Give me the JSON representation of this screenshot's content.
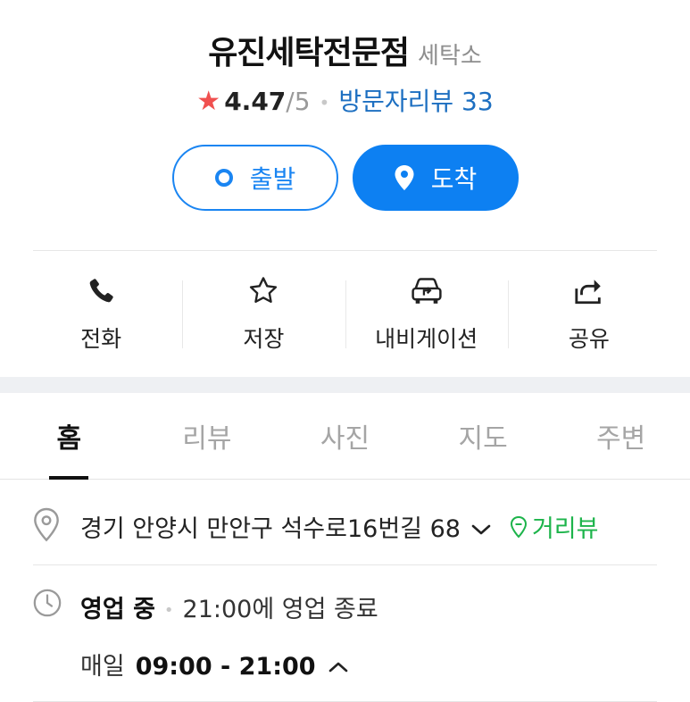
{
  "place": {
    "name": "유진세탁전문점",
    "category": "세탁소"
  },
  "rating": {
    "star_icon": "star-filled-icon",
    "score": "4.47",
    "max": "/5",
    "review_label": "방문자리뷰 33"
  },
  "route": {
    "start_label": "출발",
    "end_label": "도착"
  },
  "actions": [
    {
      "label": "전화",
      "icon": "phone-icon"
    },
    {
      "label": "저장",
      "icon": "star-outline-icon"
    },
    {
      "label": "내비게이션",
      "icon": "car-navigation-icon"
    },
    {
      "label": "공유",
      "icon": "share-icon"
    }
  ],
  "tabs": [
    {
      "label": "홈",
      "active": true
    },
    {
      "label": "리뷰",
      "active": false
    },
    {
      "label": "사진",
      "active": false
    },
    {
      "label": "지도",
      "active": false
    },
    {
      "label": "주변",
      "active": false
    }
  ],
  "address": {
    "text": "경기 안양시 만안구 석수로16번길 68",
    "street_view_label": "거리뷰"
  },
  "hours": {
    "status": "영업 중",
    "close_info": "21:00에 영업 종료",
    "day_label": "매일",
    "range": "09:00 - 21:00"
  },
  "colors": {
    "accent_blue": "#0d80f2",
    "star_red": "#f0504f",
    "street_view_green": "#1db44b",
    "review_link": "#1d6fc1"
  }
}
